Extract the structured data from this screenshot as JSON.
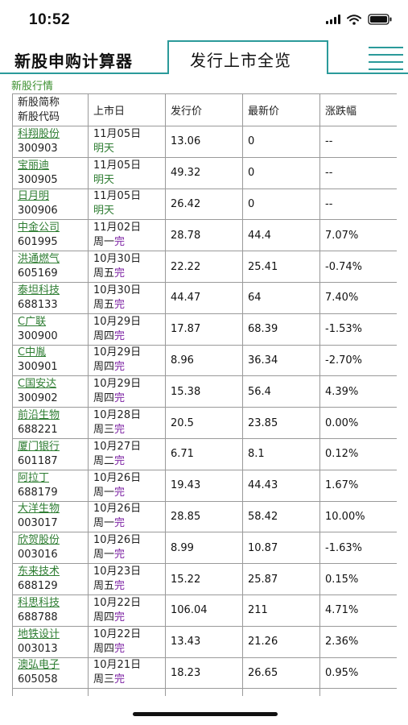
{
  "status": {
    "time": "10:52"
  },
  "tabs": {
    "calculator": "新股申购计算器",
    "overview": "发行上市全览"
  },
  "section": {
    "title": "新股行情"
  },
  "table": {
    "headers": {
      "name_line1": "新股简称",
      "name_line2": "新股代码",
      "list_date": "上市日",
      "issue_price": "发行价",
      "latest_price": "最新价",
      "change": "涨跌幅"
    },
    "rows": [
      {
        "name": "科翔股份",
        "code": "300903",
        "date": "11月05日",
        "day": "明天",
        "done": "",
        "issue": "13.06",
        "latest": "0",
        "change": "--"
      },
      {
        "name": "宝丽迪",
        "code": "300905",
        "date": "11月05日",
        "day": "明天",
        "done": "",
        "issue": "49.32",
        "latest": "0",
        "change": "--"
      },
      {
        "name": "日月明",
        "code": "300906",
        "date": "11月05日",
        "day": "明天",
        "done": "",
        "issue": "26.42",
        "latest": "0",
        "change": "--"
      },
      {
        "name": "中金公司",
        "code": "601995",
        "date": "11月02日",
        "day": "周一",
        "done": "完",
        "issue": "28.78",
        "latest": "44.4",
        "change": "7.07%"
      },
      {
        "name": "洪通燃气",
        "code": "605169",
        "date": "10月30日",
        "day": "周五",
        "done": "完",
        "issue": "22.22",
        "latest": "25.41",
        "change": "-0.74%"
      },
      {
        "name": "泰坦科技",
        "code": "688133",
        "date": "10月30日",
        "day": "周五",
        "done": "完",
        "issue": "44.47",
        "latest": "64",
        "change": "7.40%"
      },
      {
        "name": "C广联",
        "code": "300900",
        "date": "10月29日",
        "day": "周四",
        "done": "完",
        "issue": "17.87",
        "latest": "68.39",
        "change": "-1.53%"
      },
      {
        "name": "C中胤",
        "code": "300901",
        "date": "10月29日",
        "day": "周四",
        "done": "完",
        "issue": "8.96",
        "latest": "36.34",
        "change": "-2.70%"
      },
      {
        "name": "C国安达",
        "code": "300902",
        "date": "10月29日",
        "day": "周四",
        "done": "完",
        "issue": "15.38",
        "latest": "56.4",
        "change": "4.39%"
      },
      {
        "name": "前沿生物",
        "code": "688221",
        "date": "10月28日",
        "day": "周三",
        "done": "完",
        "issue": "20.5",
        "latest": "23.85",
        "change": "0.00%"
      },
      {
        "name": "厦门银行",
        "code": "601187",
        "date": "10月27日",
        "day": "周二",
        "done": "完",
        "issue": "6.71",
        "latest": "8.1",
        "change": "0.12%"
      },
      {
        "name": "阿拉丁",
        "code": "688179",
        "date": "10月26日",
        "day": "周一",
        "done": "完",
        "issue": "19.43",
        "latest": "44.43",
        "change": "1.67%"
      },
      {
        "name": "大洋生物",
        "code": "003017",
        "date": "10月26日",
        "day": "周一",
        "done": "完",
        "issue": "28.85",
        "latest": "58.42",
        "change": "10.00%"
      },
      {
        "name": "欣贺股份",
        "code": "003016",
        "date": "10月26日",
        "day": "周一",
        "done": "完",
        "issue": "8.99",
        "latest": "10.87",
        "change": "-1.63%"
      },
      {
        "name": "东来技术",
        "code": "688129",
        "date": "10月23日",
        "day": "周五",
        "done": "完",
        "issue": "15.22",
        "latest": "25.87",
        "change": "0.15%"
      },
      {
        "name": "科思科技",
        "code": "688788",
        "date": "10月22日",
        "day": "周四",
        "done": "完",
        "issue": "106.04",
        "latest": "211",
        "change": "4.71%"
      },
      {
        "name": "地铁设计",
        "code": "003013",
        "date": "10月22日",
        "day": "周四",
        "done": "完",
        "issue": "13.43",
        "latest": "21.26",
        "change": "2.36%"
      },
      {
        "name": "澳弘电子",
        "code": "605058",
        "date": "10月21日",
        "day": "周三",
        "done": "完",
        "issue": "18.23",
        "latest": "26.65",
        "change": "0.95%"
      },
      {
        "name": "",
        "code": "",
        "date": "",
        "day": "",
        "done": "",
        "issue": "",
        "latest": "",
        "change": ""
      }
    ]
  }
}
